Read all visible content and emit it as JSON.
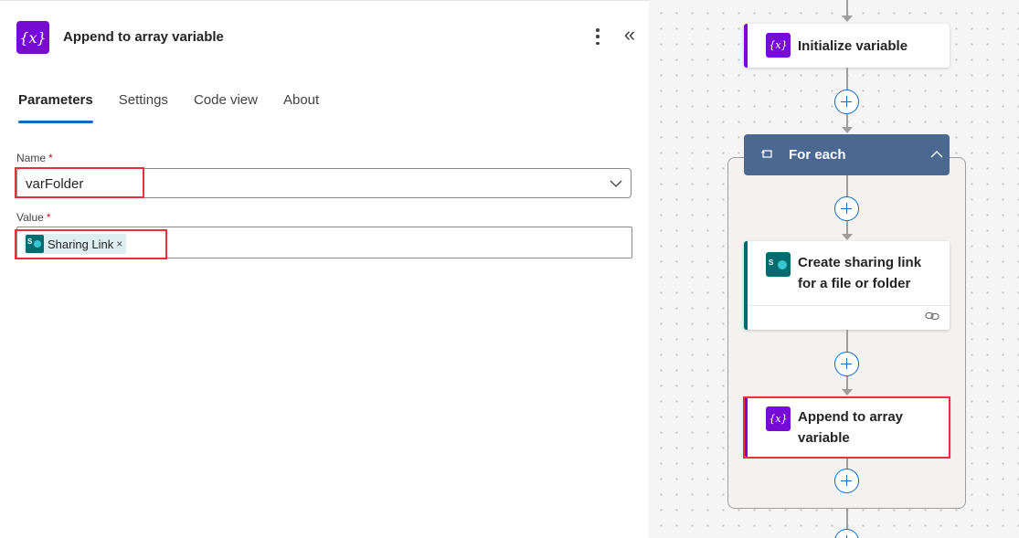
{
  "panel": {
    "icon_glyph": "{x}",
    "title": "Append to array variable",
    "more_icon": "more-vertical-icon",
    "collapse_icon": "double-chevron-left-icon",
    "collapse_glyph": "«"
  },
  "tabs": [
    {
      "label": "Parameters",
      "active": true
    },
    {
      "label": "Settings",
      "active": false
    },
    {
      "label": "Code view",
      "active": false
    },
    {
      "label": "About",
      "active": false
    }
  ],
  "fields": {
    "name": {
      "label": "Name",
      "required_mark": "*",
      "value": "varFolder"
    },
    "value": {
      "label": "Value",
      "required_mark": "*",
      "token": "Sharing Link",
      "token_remove": "×"
    }
  },
  "flow": {
    "initialize": {
      "label": "Initialize variable",
      "icon_glyph": "{x}"
    },
    "foreach": {
      "label": "For each"
    },
    "sharing": {
      "line1": "Create sharing link",
      "line2": "for a file or folder"
    },
    "append": {
      "line1": "Append to array",
      "line2": "variable",
      "icon_glyph": "{x}"
    }
  },
  "colors": {
    "variable_purple": "#770bd6",
    "sharepoint_teal": "#036c70",
    "foreach_blue": "#4a6890",
    "accent_blue": "#0f6cbd",
    "highlight_red": "#e3343b"
  }
}
